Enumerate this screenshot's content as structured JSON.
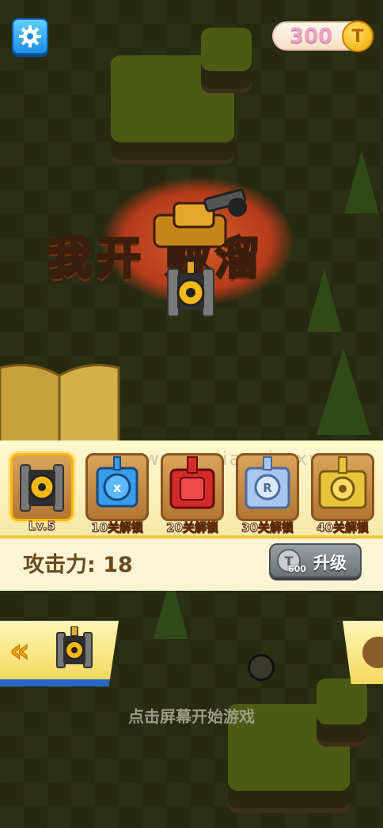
{
  "header": {
    "coins": "300",
    "coin_symbol": "T"
  },
  "logo": {
    "title": "我开坦克贼溜",
    "visible_title": "我开  贼溜"
  },
  "tank_selector": {
    "slots": [
      {
        "label": "Lv.5",
        "color": "#3a3a3a",
        "selected": true
      },
      {
        "label": "10关解锁",
        "color": "#2f8fe8",
        "selected": false
      },
      {
        "label": "20关解锁",
        "color": "#d42a2a",
        "selected": false
      },
      {
        "label": "30关解锁",
        "color": "#a9c6ee",
        "selected": false
      },
      {
        "label": "40关解锁",
        "color": "#e8c43a",
        "selected": false
      }
    ],
    "attack_label": "攻击力: 18",
    "upgrade_cost": "600",
    "upgrade_coin_symbol": "T",
    "upgrade_label": "升级"
  },
  "footer": {
    "back_symbol": "«",
    "start_hint": "点击屏幕开始游戏"
  },
  "watermark": "www.yyxiaoxin.xyz"
}
